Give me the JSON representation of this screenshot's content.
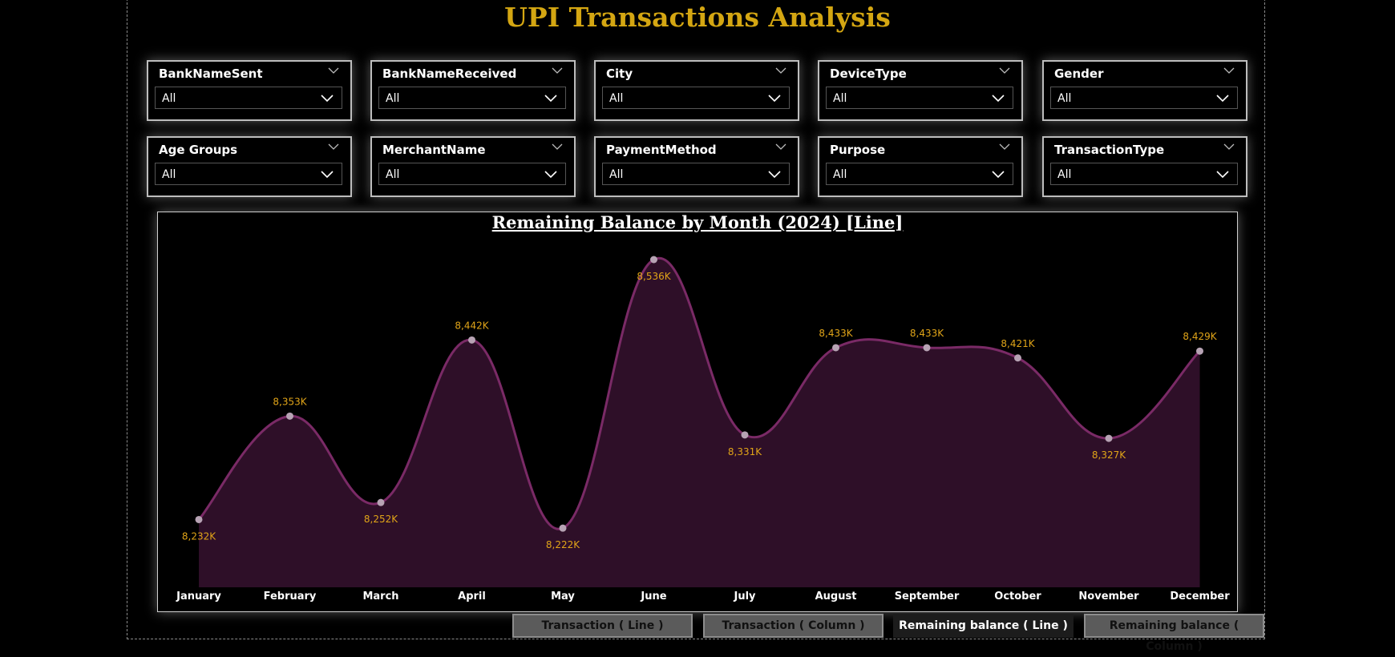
{
  "report": {
    "title": "UPI Transactions Analysis"
  },
  "slicers": [
    {
      "label": "BankNameSent",
      "value": "All"
    },
    {
      "label": "BankNameReceived",
      "value": "All"
    },
    {
      "label": "City",
      "value": "All"
    },
    {
      "label": "DeviceType",
      "value": "All"
    },
    {
      "label": "Gender",
      "value": "All"
    },
    {
      "label": "Age Groups",
      "value": "All"
    },
    {
      "label": "MerchantName",
      "value": "All"
    },
    {
      "label": "PaymentMethod",
      "value": "All"
    },
    {
      "label": "Purpose",
      "value": "All"
    },
    {
      "label": "TransactionType",
      "value": "All"
    }
  ],
  "chart_data": {
    "type": "area",
    "title": "Remaining Balance by Month (2024) [Line]",
    "categories": [
      "January",
      "February",
      "March",
      "April",
      "May",
      "June",
      "July",
      "August",
      "September",
      "October",
      "November",
      "December"
    ],
    "values": [
      8232,
      8353,
      8252,
      8442,
      8222,
      8536,
      8331,
      8433,
      8433,
      8421,
      8327,
      8429
    ],
    "data_labels": [
      "8,232K",
      "8,353K",
      "8,252K",
      "8,442K",
      "8,222K",
      "8,536K",
      "8,331K",
      "8,433K",
      "8,433K",
      "8,421K",
      "8,327K",
      "8,429K"
    ],
    "unit": "K",
    "ylim": [
      8180,
      8536
    ],
    "line_color": "#7a2a66",
    "fill_color": "#2e0f28",
    "marker_color": "#b7a3b4",
    "label_color": "#e0a418",
    "grid": false,
    "legend": "none"
  },
  "tabs": [
    {
      "label": "Transaction ( Line )",
      "active": false
    },
    {
      "label": "Transaction ( Column )",
      "active": false
    },
    {
      "label": "Remaining balance ( Line )",
      "active": true
    },
    {
      "label": "Remaining balance ( Column )",
      "active": false
    }
  ]
}
